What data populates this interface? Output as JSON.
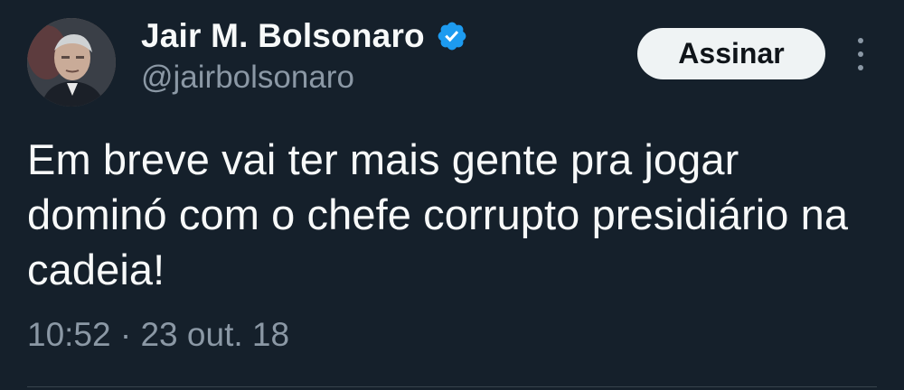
{
  "tweet": {
    "author_name": "Jair M. Bolsonaro",
    "handle": "@jairbolsonaro",
    "verified_icon": "verified-badge-icon",
    "subscribe_label": "Assinar",
    "more_icon": "more-vertical-icon",
    "text": "Em breve vai ter mais gente pra jogar dominó com o chefe corrupto presidiário na cadeia!",
    "time": "10:52",
    "separator": "·",
    "date": "23 out. 18"
  },
  "colors": {
    "background": "#15202b",
    "primary_text": "#f7f9f9",
    "secondary_text": "#8b98a5",
    "verified": "#1d9bf0",
    "button_bg": "#eff3f4"
  }
}
